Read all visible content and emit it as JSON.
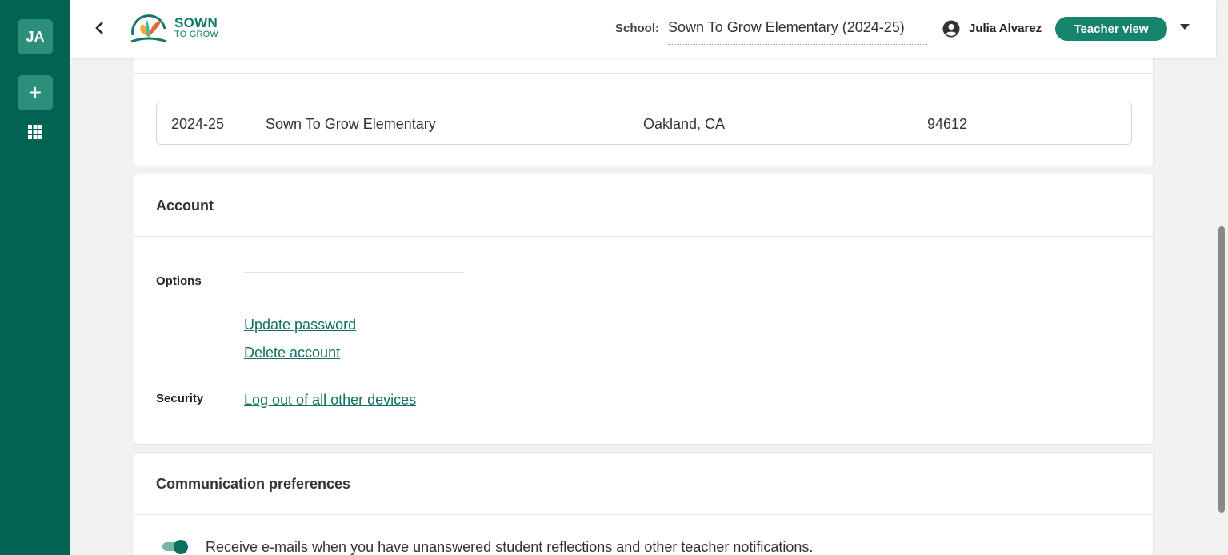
{
  "rail": {
    "avatar_initials": "JA",
    "add_label": "+"
  },
  "header": {
    "logo_line1": "SOWN",
    "logo_line2": "TO GROW",
    "school_label": "School:",
    "school_value": "Sown To Grow Elementary (2024-25)",
    "user_name": "Julia Alvarez",
    "view_label": "Teacher view"
  },
  "school_row": {
    "year": "2024-25",
    "name": "Sown To Grow Elementary",
    "location": "Oakland, CA",
    "zip": "94612"
  },
  "account": {
    "title": "Account",
    "options_label": "Options",
    "update_password": "Update password",
    "delete_account": "Delete account",
    "security_label": "Security",
    "logout_all": "Log out of all other devices"
  },
  "communication": {
    "title": "Communication preferences",
    "email_pref": "Receive e-mails when you have unanswered student reflections and other teacher notifications.",
    "email_pref_enabled": true
  },
  "colors": {
    "rail": "#016452",
    "accent": "#16836c",
    "link": "#117060"
  }
}
